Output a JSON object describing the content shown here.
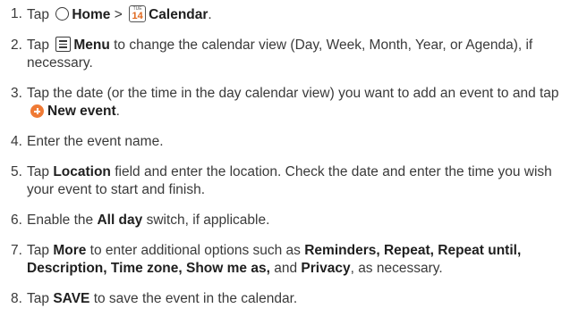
{
  "steps": [
    {
      "num": "1.",
      "t1": "Tap",
      "home": "Home",
      "gt": ">",
      "cal_month": "TUE",
      "cal_day": "14",
      "calendar": "Calendar",
      "end": "."
    },
    {
      "num": "2.",
      "t1": "Tap",
      "menu": "Menu",
      "t2": "to change the calendar view (Day, Week, Month, Year, or Agenda), if necessary."
    },
    {
      "num": "3.",
      "t1": "Tap the date (or the time in the day calendar view) you want to add an event to and tap",
      "new_event": "New event",
      "end": "."
    },
    {
      "num": "4.",
      "text": "Enter the event name."
    },
    {
      "num": "5.",
      "t1": "Tap",
      "location": "Location",
      "t2": "field and enter the location. Check the date and enter the time you wish your event to start and finish."
    },
    {
      "num": "6.",
      "t1": "Enable the",
      "all_day": "All day",
      "t2": "switch, if applicable."
    },
    {
      "num": "7.",
      "t1": "Tap",
      "more": "More",
      "t2": "to enter additional options such as",
      "reminders": "Reminders, Repeat, Repeat until, Description, Time zone, Show me as,",
      "and": "and",
      "privacy": "Privacy",
      "end": ", as necessary."
    },
    {
      "num": "8.",
      "t1": "Tap",
      "save": "SAVE",
      "t2": "to save the event in the calendar."
    }
  ],
  "icons": {
    "home": "home-circle-icon",
    "calendar": "calendar-app-icon",
    "menu": "menu-icon",
    "new_event": "plus-circle-icon"
  },
  "colors": {
    "accent": "#ef7a35",
    "calendar_day": "#e0671c"
  }
}
